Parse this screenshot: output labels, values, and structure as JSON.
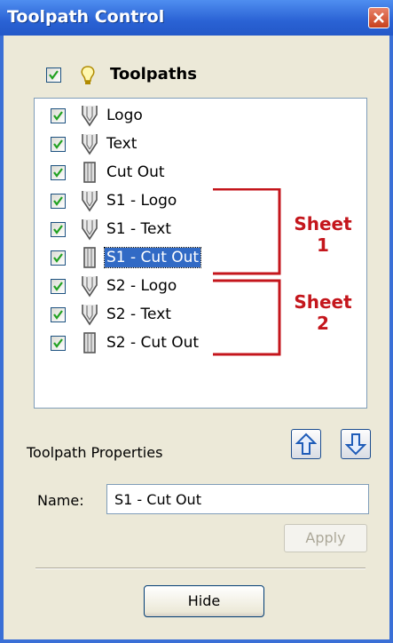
{
  "window": {
    "title": "Toolpath Control"
  },
  "header": {
    "label": "Toolpaths"
  },
  "toolpaths": [
    {
      "label": "Logo",
      "checked": true,
      "tool": "v-bit"
    },
    {
      "label": "Text",
      "checked": true,
      "tool": "v-bit"
    },
    {
      "label": "Cut Out",
      "checked": true,
      "tool": "end-mill"
    },
    {
      "label": "S1 - Logo",
      "checked": true,
      "tool": "v-bit"
    },
    {
      "label": "S1 - Text",
      "checked": true,
      "tool": "v-bit"
    },
    {
      "label": "S1 - Cut Out",
      "checked": true,
      "tool": "end-mill",
      "selected": true
    },
    {
      "label": "S2 - Logo",
      "checked": true,
      "tool": "v-bit"
    },
    {
      "label": "S2 - Text",
      "checked": true,
      "tool": "v-bit"
    },
    {
      "label": "S2 - Cut Out",
      "checked": true,
      "tool": "end-mill"
    }
  ],
  "annotations": {
    "sheet1": {
      "line1": "Sheet",
      "line2": "1"
    },
    "sheet2": {
      "line1": "Sheet",
      "line2": "2"
    },
    "color": "#c4161c"
  },
  "properties": {
    "label": "Toolpath Properties",
    "name_label": "Name:",
    "name_value": "S1 - Cut Out",
    "apply_label": "Apply",
    "hide_label": "Hide"
  },
  "colors": {
    "titlebar": "#2a62d4",
    "selection": "#316ac5",
    "panel": "#ece9d8"
  }
}
